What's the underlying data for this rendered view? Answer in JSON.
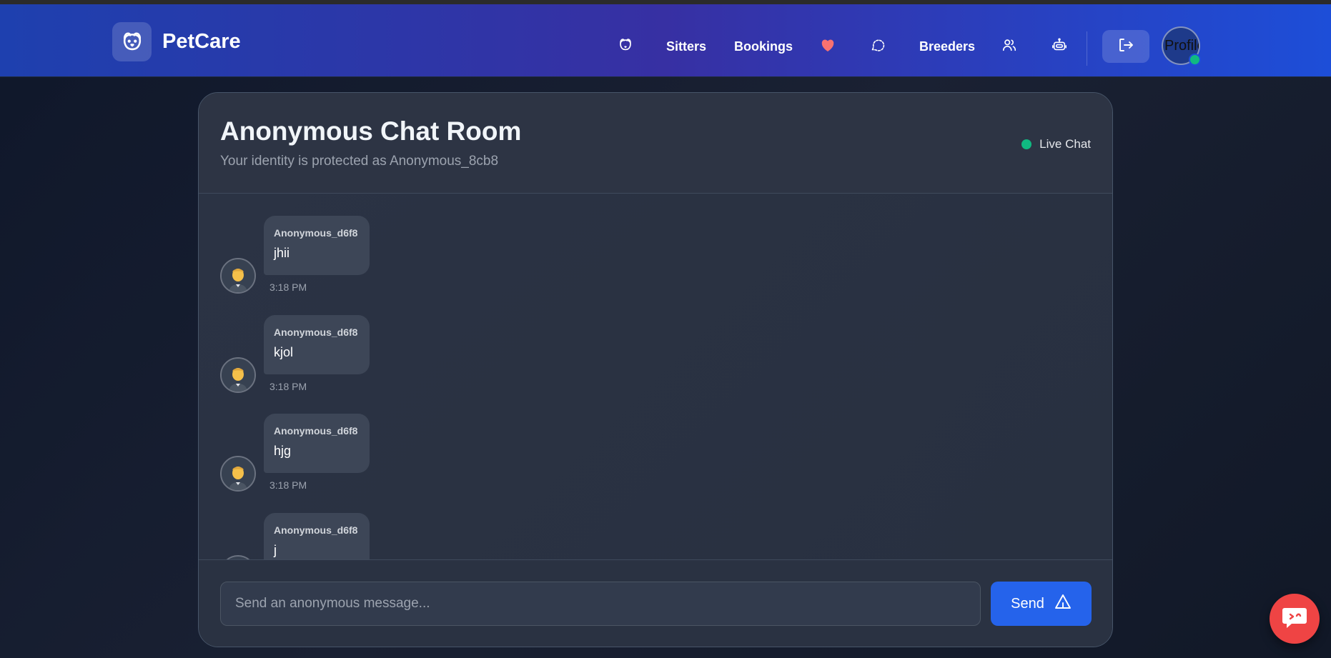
{
  "app": {
    "name": "PetCare"
  },
  "nav": {
    "items": [
      {
        "id": "pets",
        "icon": "paw-icon"
      },
      {
        "id": "sitters",
        "label": "Sitters"
      },
      {
        "id": "bookings",
        "label": "Bookings"
      },
      {
        "id": "favorites",
        "icon": "heart-icon"
      },
      {
        "id": "chat",
        "icon": "chat-bubble-icon"
      },
      {
        "id": "breeders",
        "label": "Breeders"
      },
      {
        "id": "community",
        "icon": "users-icon"
      },
      {
        "id": "ai-assistant",
        "icon": "robot-icon"
      }
    ],
    "logout_icon": "logout-icon",
    "profile_alt": "Profile"
  },
  "colors": {
    "accent": "#2563eb",
    "online": "#10b981",
    "heart": "#f87171",
    "fab": "#ef4444"
  },
  "chat": {
    "title": "Anonymous Chat Room",
    "subtitle": "Your identity is protected as Anonymous_8cb8",
    "status": "Live Chat",
    "messages": [
      {
        "sender": "Anonymous_d6f8",
        "text": "jhii",
        "time": "3:18 PM"
      },
      {
        "sender": "Anonymous_d6f8",
        "text": "kjol",
        "time": "3:18 PM"
      },
      {
        "sender": "Anonymous_d6f8",
        "text": "hjg",
        "time": "3:18 PM"
      },
      {
        "sender": "Anonymous_d6f8",
        "text": "j",
        "time": ""
      }
    ],
    "input_placeholder": "Send an anonymous message...",
    "send_label": "Send"
  }
}
